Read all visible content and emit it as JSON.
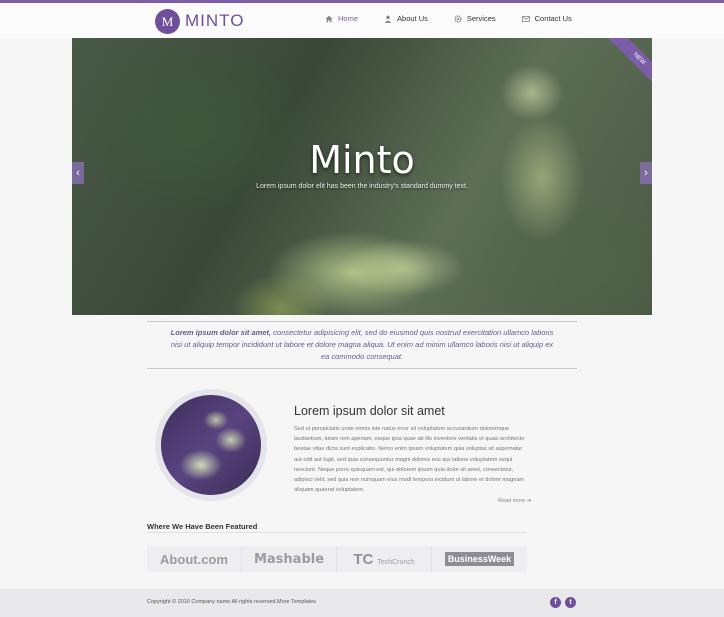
{
  "brand": {
    "logo_letter": "M",
    "name": "MINTO"
  },
  "nav": {
    "items": [
      {
        "label": "Home",
        "icon": "home-icon",
        "active": true
      },
      {
        "label": "About Us",
        "icon": "user-icon",
        "active": false
      },
      {
        "label": "Services",
        "icon": "gear-icon",
        "active": false
      },
      {
        "label": "Contact Us",
        "icon": "mail-icon",
        "active": false
      }
    ]
  },
  "hero": {
    "title": "Minto",
    "subtitle": "Lorem ipsum dolor elit has been the industry's standard dummy text.",
    "badge": "NEW",
    "prev": "‹",
    "next": "›"
  },
  "intro": {
    "lead": "Lorem ipsum dolor sit amet,",
    "text": " consectetur adipisicing elit, sed do eiusmod quis nostrud exercitation ullamco laboris nisi ut aliquip tempor incididunt ut labore et dolore magna aliqua. Ut enim ad minim ullamco laboris nisi ut aliquip ex ea commodo consequat."
  },
  "article": {
    "title": "Lorem ipsum dolor sit amet",
    "body": "Sed ut perspiciatis unde omnis iste natus error sit voluptatem accusantium doloremque laudantium, totam rem aperiam, eaque ipsa quae ab illo inventore veritatis et quasi architecto beatae vitae dicta sunt explicabo. Nemo enim ipsam voluptatem quia voluptas sit aspernatur aut odit aut fugit, sed quia consequuntur magni dolores eos qui ratione voluptatem sequi nesciunt. Neque porro quisquam est, qui dolorem ipsum quia dolor sit amet, consectetur, adipisci velit, sed quia non numquam eius modi tempora incidunt ut labore et dolore magnam aliquam quaerat voluptatem.",
    "read_more": "Read more ➜"
  },
  "featured": {
    "title": "Where We Have Been Featured",
    "logos": [
      "About.com",
      "Mashable",
      "TechCrunch",
      "BusinessWeek"
    ]
  },
  "footer": {
    "text": "Copyright © 2016 Company name All rights reserved.More Templates",
    "social": [
      "f",
      "t"
    ]
  },
  "colors": {
    "accent": "#7b5ea7",
    "logo": "#6f4f9c"
  }
}
